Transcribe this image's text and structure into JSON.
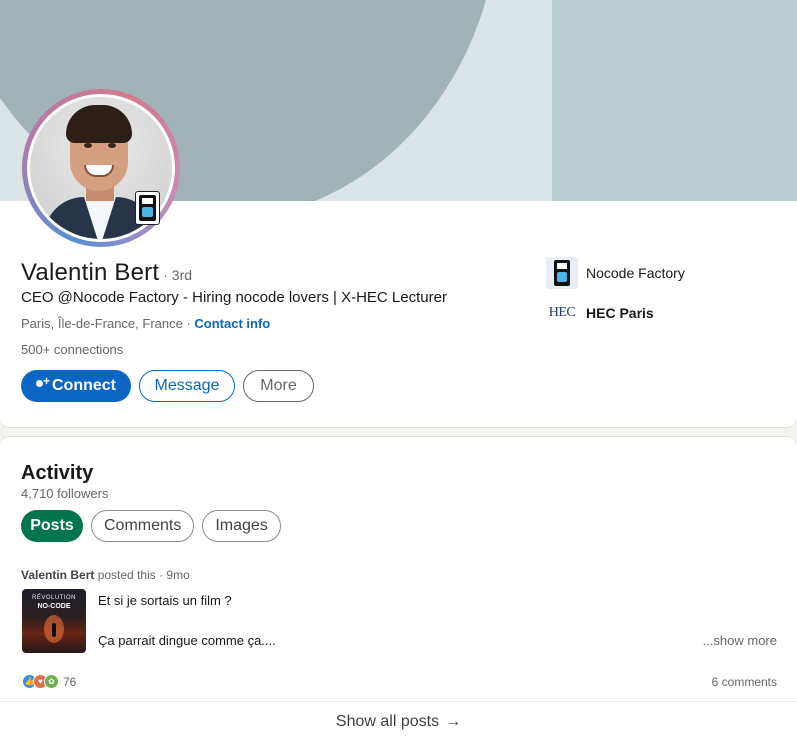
{
  "profile": {
    "name": "Valentin Bert",
    "degree": "· 3rd",
    "headline": "CEO @Nocode Factory - Hiring nocode lovers | X-HEC Lecturer",
    "location": "Paris, Île-de-France, France",
    "location_sep": " · ",
    "contact_info": "Contact info",
    "connections": "500+ connections",
    "actions": {
      "connect": "Connect",
      "message": "Message",
      "more": "More"
    },
    "experience": [
      {
        "name": "Nocode Factory",
        "logo": "nocode-factory-logo"
      },
      {
        "name": "HEC Paris",
        "logo": "hec-paris-logo",
        "logo_text": "HEC"
      }
    ]
  },
  "activity": {
    "title": "Activity",
    "followers": "4,710 followers",
    "tabs": [
      "Posts",
      "Comments",
      "Images"
    ],
    "active_tab": "Posts",
    "post": {
      "author": "Valentin Bert",
      "meta": " posted this · 9mo",
      "thumbnail_line1": "RÉVOLUTION",
      "thumbnail_line2": "NO-CODE",
      "line1": "Et si je sortais un film ?",
      "line2": "Ça parrait dingue comme ça....",
      "show_more": "...show more",
      "reaction_count": "76",
      "comments": "6 comments"
    },
    "show_all": "Show all posts"
  },
  "colors": {
    "primary": "#0a66c2",
    "active_tab": "#01754f",
    "banner_left": "#a1b3b7",
    "banner_right": "#bcd0d4",
    "banner_mid": "#dbe4e6"
  }
}
